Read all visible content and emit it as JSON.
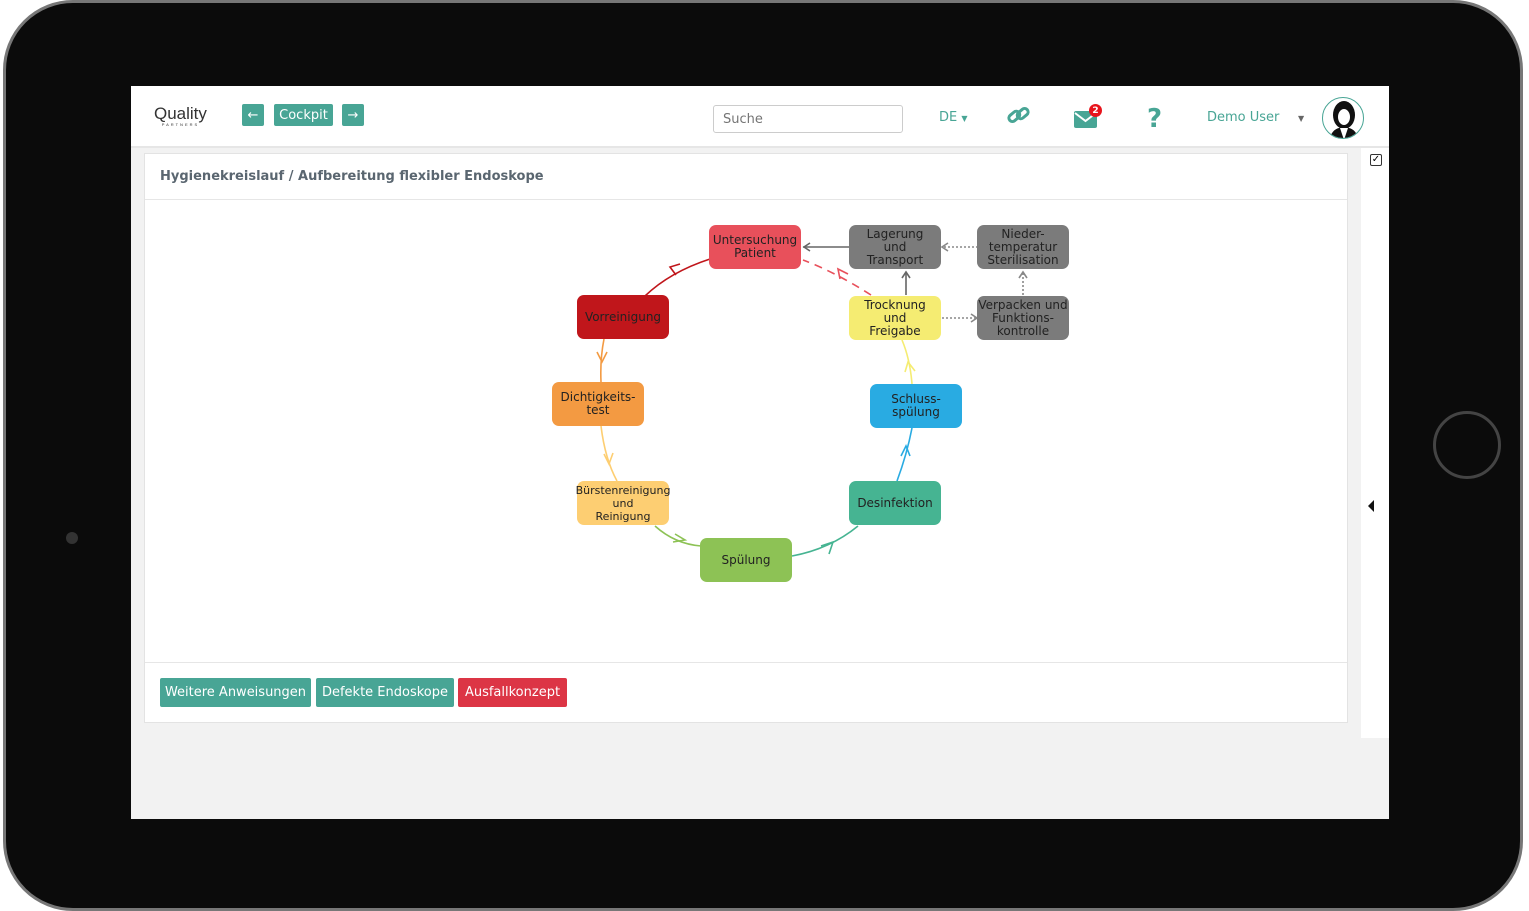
{
  "header": {
    "logo": "Quality",
    "logo_sub": "PARTNERS",
    "back_icon": "arrow-left-icon",
    "cockpit_label": "Cockpit",
    "forward_icon": "arrow-right-icon",
    "search_placeholder": "Suche",
    "language": "DE",
    "link_icon": "link-icon",
    "mail_icon": "envelope-icon",
    "mail_badge": "2",
    "help_icon": "question-icon",
    "user_name": "Demo User",
    "avatar_icon": "user-avatar"
  },
  "page": {
    "breadcrumb": "Hygienekreislauf / Aufbereitung flexibler Endoskope"
  },
  "diagram": {
    "nodes": [
      {
        "id": "untersuchung",
        "label": "Untersuchung\nPatient",
        "color": "#e8505b"
      },
      {
        "id": "lagerung",
        "label": "Lagerung\nund\nTransport",
        "color": "#7b7b7b"
      },
      {
        "id": "sterilisation",
        "label": "Nieder-\ntemperatur\nSterilisation",
        "color": "#7b7b7b"
      },
      {
        "id": "vorreinigung",
        "label": "Vorreinigung",
        "color": "#c0161b"
      },
      {
        "id": "trocknung",
        "label": "Trocknung\nund\nFreigabe",
        "color": "#f5ec72"
      },
      {
        "id": "verpacken",
        "label": "Verpacken und\nFunktions-\nkontrolle",
        "color": "#7b7b7b"
      },
      {
        "id": "dichtigkeit",
        "label": "Dichtigkeits-\ntest",
        "color": "#f39a42"
      },
      {
        "id": "schluss",
        "label": "Schluss-\nspülung",
        "color": "#29abe2"
      },
      {
        "id": "buersten",
        "label": "Bürstenreinigung\nund\nReinigung",
        "color": "#fdce72"
      },
      {
        "id": "desinfektion",
        "label": "Desinfektion",
        "color": "#46b492"
      },
      {
        "id": "spuelung",
        "label": "Spülung",
        "color": "#8dc255"
      }
    ]
  },
  "footer": {
    "buttons": [
      {
        "label": "Weitere Anweisungen",
        "color": "#48a595"
      },
      {
        "label": "Defekte Endoskope",
        "color": "#48a595"
      },
      {
        "label": "Ausfallkonzept",
        "color": "#dc3545"
      }
    ]
  },
  "sidebar": {
    "checklist_icon": "checkbox-icon",
    "collapse_icon": "caret-left-icon"
  }
}
